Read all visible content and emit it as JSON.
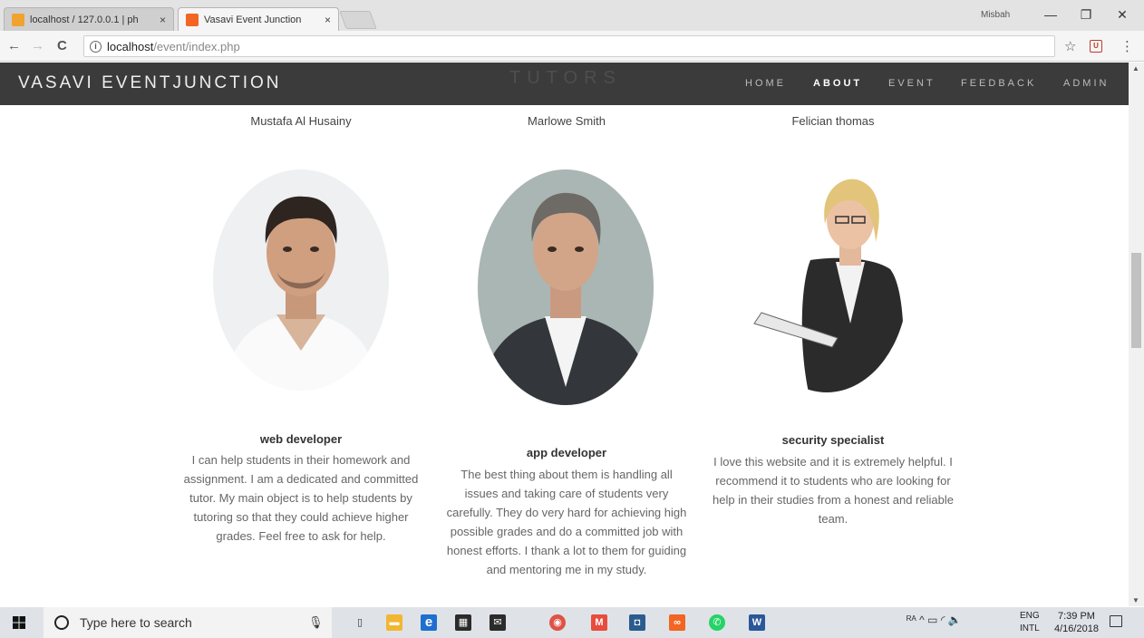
{
  "browser": {
    "tabs": [
      {
        "title": "localhost / 127.0.0.1 | ph",
        "favicon_color": "#f0a32f"
      },
      {
        "title": "Vasavi Event Junction",
        "favicon_color": "#f26522"
      }
    ],
    "close_glyph": "×",
    "user": "Misbah",
    "window_buttons": {
      "minimize": "—",
      "maximize": "❐",
      "close": "✕"
    },
    "url_host": "localhost",
    "url_path": "/event/index.php",
    "info_glyph": "i",
    "star_glyph": "☆",
    "menu_glyph": "⋮",
    "ext_glyph": "U",
    "back_glyph": "←",
    "forward_glyph": "→",
    "reload_glyph": "C"
  },
  "site": {
    "brand": "VASAVI EVENTJUNCTION",
    "section_ghost": "TUTORS",
    "nav": [
      "HOME",
      "ABOUT",
      "EVENT",
      "FEEDBACK",
      "ADMIN"
    ],
    "active_nav": "ABOUT"
  },
  "tutors": [
    {
      "name": "Mustafa Al Husainy",
      "role": "web developer",
      "description": "I can help students in their homework and assignment. I am a dedicated and committed tutor. My main object is to help students by tutoring so that they could achieve higher grades. Feel free to ask for help."
    },
    {
      "name": "Marlowe Smith",
      "role": "app developer",
      "description": "The best thing about them is handling all issues and taking care of students very carefully. They do very hard for achieving high possible grades and do a committed job with honest efforts. I thank a lot to them for guiding and mentoring me in my study."
    },
    {
      "name": "Felician thomas",
      "role": "security specialist",
      "description": "I love this website and it is extremely helpful. I recommend it to students who are looking for help in their studies from a honest and reliable team."
    }
  ],
  "taskbar": {
    "search_placeholder": "Type here to search",
    "mic_glyph": "🎙",
    "lang_top": "ENG",
    "lang_bottom": "INTL",
    "time": "7:39 PM",
    "date": "4/16/2018",
    "tray_glyphs": "ᴿᴬ  ^  ▭  ◜  🔈",
    "apps": [
      {
        "name": "task-view",
        "color": "#555555",
        "glyph": "▯"
      },
      {
        "name": "file-explorer",
        "color": "#f2b632",
        "glyph": "▬"
      },
      {
        "name": "edge",
        "color": "#1e6fd0",
        "glyph": "e"
      },
      {
        "name": "store",
        "color": "#2b2b2b",
        "glyph": "▦"
      },
      {
        "name": "mail",
        "color": "#2b2b2b",
        "glyph": "✉"
      },
      {
        "name": "chrome",
        "color": "#de5246",
        "glyph": "◉"
      },
      {
        "name": "gmail",
        "color": "#e74c3c",
        "glyph": "M"
      },
      {
        "name": "app-box",
        "color": "#2c5c8f",
        "glyph": "◘"
      },
      {
        "name": "xampp",
        "color": "#f26522",
        "glyph": "∞"
      },
      {
        "name": "whatsapp",
        "color": "#25d366",
        "glyph": "✆"
      },
      {
        "name": "word",
        "color": "#2b579a",
        "glyph": "W"
      }
    ]
  }
}
